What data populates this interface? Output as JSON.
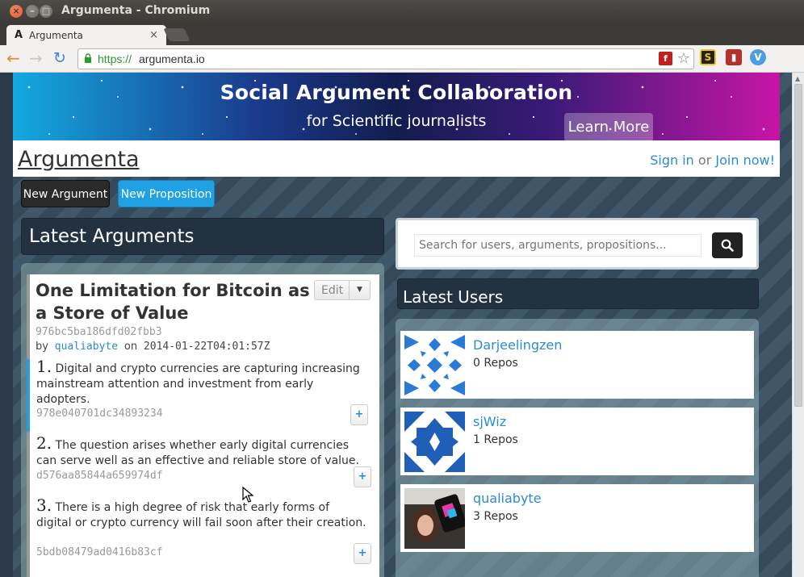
{
  "window": {
    "title": "Argumenta - Chromium",
    "close_glyph": "×",
    "min_glyph": "–",
    "max_glyph": "□"
  },
  "browser": {
    "tab": {
      "favicon": "A",
      "title": "Argumenta",
      "close_glyph": "×"
    },
    "url_scheme": "https://",
    "url_host": "argumenta.io",
    "icons": [
      "back-arrow-icon",
      "forward-arrow-icon",
      "reload-icon",
      "lock-icon",
      "flash-icon",
      "bookmark-star-icon",
      "extension-s-icon",
      "extension-book-icon",
      "extension-v-icon",
      "menu-icon"
    ]
  },
  "banner": {
    "title": "Social Argument Collaboration",
    "subtitle": "for Scientific journalists",
    "learn_more": "Learn More"
  },
  "header": {
    "logo": "Argumenta",
    "sign_in": "Sign in",
    "or_text": "or",
    "join": "Join now!"
  },
  "actions": {
    "new_argument": "New Argument",
    "new_proposition": "New Proposition"
  },
  "latest_arguments": {
    "heading": "Latest Arguments",
    "argument": {
      "title": "One Limitation for Bitcoin as a Store of Value",
      "hash": "976bc5ba186dfd02fbb3",
      "by_label": "by",
      "author": "qualiabyte",
      "on_label": "on",
      "timestamp": "2014-01-22T04:01:57Z",
      "edit_label": "Edit",
      "propositions": [
        {
          "number": "1.",
          "text": "Digital and crypto currencies are capturing increasing mainstream attention and investment from early adopters.",
          "hash": "978e040701dc34893234"
        },
        {
          "number": "2.",
          "text": "The question arises whether early digital currencies can serve well as an effective and reliable store of value.",
          "hash": "d576aa85844a659974df"
        },
        {
          "number": "3.",
          "text": "There is a high degree of risk that early forms of digital or crypto currency will fail soon after their creation.",
          "hash": "5bdb08479ad0416b83cf"
        }
      ],
      "plus_label": "+"
    }
  },
  "search": {
    "placeholder": "Search for users, arguments, propositions..."
  },
  "latest_users": {
    "heading": "Latest Users",
    "users": [
      {
        "name": "Darjeelingzen",
        "repos": "0 Repos"
      },
      {
        "name": "sjWiz",
        "repos": "1 Repos"
      },
      {
        "name": "qualiabyte",
        "repos": "3 Repos"
      }
    ]
  },
  "colors": {
    "accent": "#1fa1e3",
    "link": "#2a8bd6",
    "panel_dark": "#233240",
    "url_green": "#2c9a2c"
  }
}
